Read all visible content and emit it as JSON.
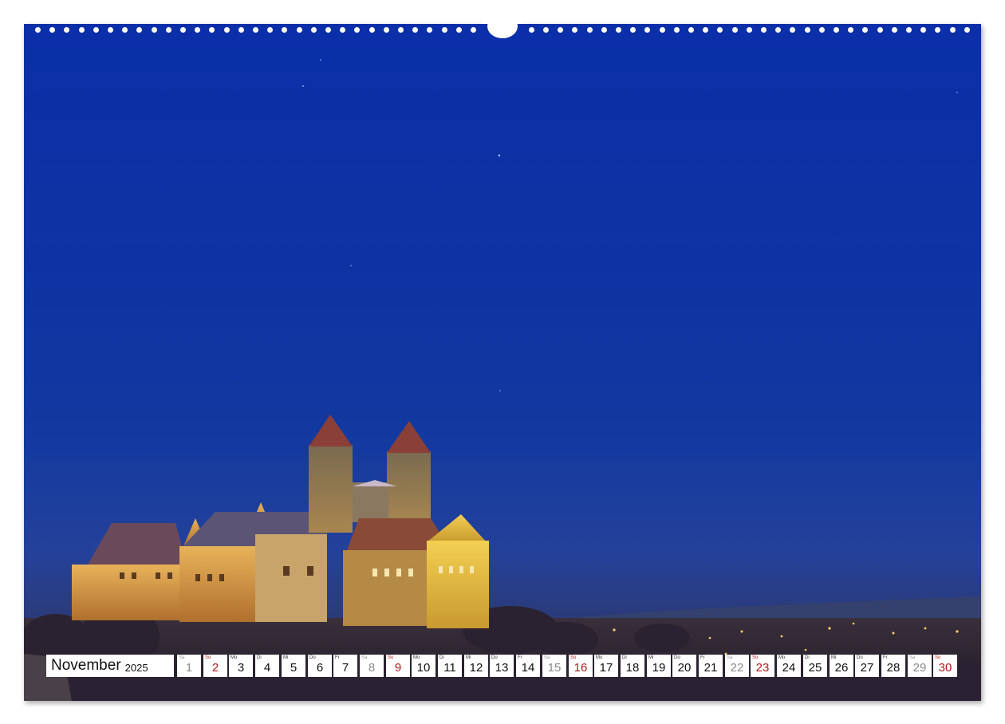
{
  "calendar": {
    "month": "November",
    "year": "2025",
    "days": [
      {
        "wd": "Sa",
        "n": "1",
        "type": "sat"
      },
      {
        "wd": "So",
        "n": "2",
        "type": "sun"
      },
      {
        "wd": "Mo",
        "n": "3",
        "type": "wk"
      },
      {
        "wd": "Di",
        "n": "4",
        "type": "wk"
      },
      {
        "wd": "Mi",
        "n": "5",
        "type": "wk"
      },
      {
        "wd": "Do",
        "n": "6",
        "type": "wk"
      },
      {
        "wd": "Fr",
        "n": "7",
        "type": "wk"
      },
      {
        "wd": "Sa",
        "n": "8",
        "type": "sat"
      },
      {
        "wd": "So",
        "n": "9",
        "type": "sun"
      },
      {
        "wd": "Mo",
        "n": "10",
        "type": "wk"
      },
      {
        "wd": "Di",
        "n": "11",
        "type": "wk"
      },
      {
        "wd": "Mi",
        "n": "12",
        "type": "wk"
      },
      {
        "wd": "Do",
        "n": "13",
        "type": "wk"
      },
      {
        "wd": "Fr",
        "n": "14",
        "type": "wk"
      },
      {
        "wd": "Sa",
        "n": "15",
        "type": "sat"
      },
      {
        "wd": "So",
        "n": "16",
        "type": "sun"
      },
      {
        "wd": "Mo",
        "n": "17",
        "type": "wk"
      },
      {
        "wd": "Di",
        "n": "18",
        "type": "wk"
      },
      {
        "wd": "Mi",
        "n": "19",
        "type": "wk"
      },
      {
        "wd": "Do",
        "n": "20",
        "type": "wk"
      },
      {
        "wd": "Fr",
        "n": "21",
        "type": "wk"
      },
      {
        "wd": "Sa",
        "n": "22",
        "type": "sat"
      },
      {
        "wd": "So",
        "n": "23",
        "type": "sun"
      },
      {
        "wd": "Mo",
        "n": "24",
        "type": "wk"
      },
      {
        "wd": "Di",
        "n": "25",
        "type": "wk"
      },
      {
        "wd": "Mi",
        "n": "26",
        "type": "wk"
      },
      {
        "wd": "Do",
        "n": "27",
        "type": "wk"
      },
      {
        "wd": "Fr",
        "n": "28",
        "type": "wk"
      },
      {
        "wd": "Sa",
        "n": "29",
        "type": "sat"
      },
      {
        "wd": "So",
        "n": "30",
        "type": "sun"
      }
    ]
  },
  "colors": {
    "sky": "#0d33a3",
    "castle_light": "#e0a94a",
    "sunday": "#b01a1a",
    "saturday": "#8a8a8a"
  }
}
